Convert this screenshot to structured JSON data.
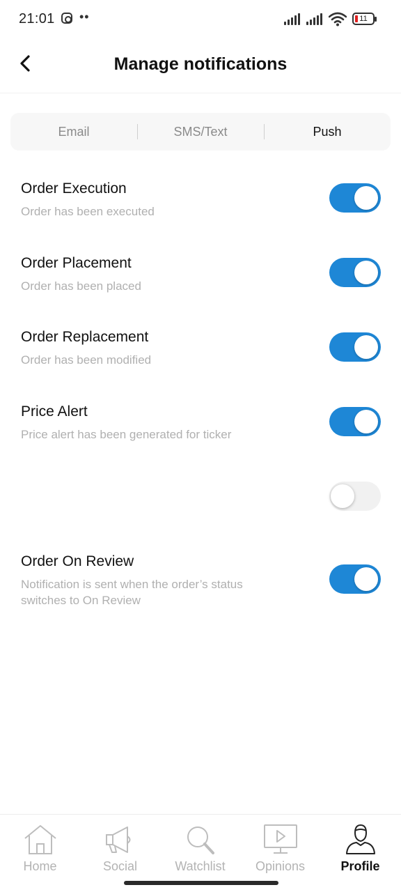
{
  "status_bar": {
    "time": "21:01",
    "battery_level": "11",
    "icons": [
      "instagram-icon",
      "more-dots-icon",
      "signal-icon",
      "signal-icon",
      "wifi-icon",
      "battery-icon"
    ],
    "dots": "••"
  },
  "header": {
    "back_icon": "chevron-left-icon",
    "title": "Manage notifications"
  },
  "tabs": [
    {
      "label": "Email",
      "active": false
    },
    {
      "label": "SMS/Text",
      "active": false
    },
    {
      "label": "Push",
      "active": true
    }
  ],
  "notifications": [
    {
      "name": "Order Execution",
      "description": "Order has been executed",
      "enabled": true
    },
    {
      "name": "Order Placement",
      "description": "Order has been placed",
      "enabled": true
    },
    {
      "name": "Order Replacement",
      "description": "Order has been modified",
      "enabled": true
    },
    {
      "name": "Price Alert",
      "description": "Price alert has been generated for ticker",
      "enabled": true
    },
    {
      "name": "",
      "description": "",
      "enabled": false
    },
    {
      "name": "Order On Review",
      "description": "Notification is sent when the order’s status switches to On Review",
      "enabled": true
    }
  ],
  "bottom_nav": [
    {
      "label": "Home",
      "icon": "home-icon",
      "active": false
    },
    {
      "label": "Social",
      "icon": "megaphone-icon",
      "active": false
    },
    {
      "label": "Watchlist",
      "icon": "magnifier-icon",
      "active": false
    },
    {
      "label": "Opinions",
      "icon": "video-play-icon",
      "active": false
    },
    {
      "label": "Profile",
      "icon": "profile-icon",
      "active": true
    }
  ],
  "colors": {
    "accent": "#1e87d6",
    "toggle_off": "#f1f1f1",
    "muted_text": "#b0b0b0",
    "nav_inactive": "#b3b3b3"
  }
}
